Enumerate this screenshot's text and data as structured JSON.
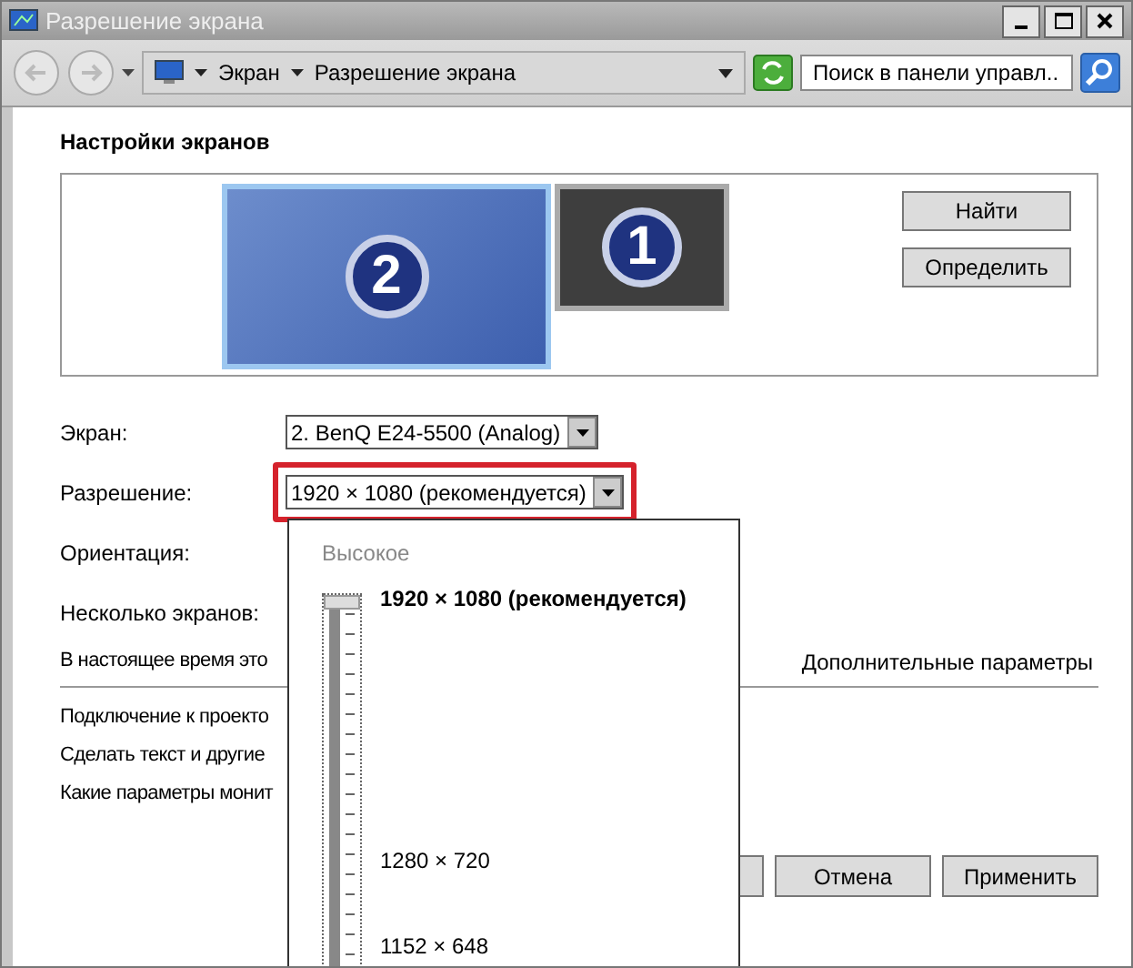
{
  "window": {
    "title": "Разрешение экрана"
  },
  "nav": {
    "breadcrumb": [
      "Экран",
      "Разрешение экрана"
    ],
    "search": {
      "placeholder": "Поиск в панели управл..."
    }
  },
  "heading": "Настройки экранов",
  "monitors": [
    {
      "number": "2",
      "selected": true
    },
    {
      "number": "1",
      "selected": false
    }
  ],
  "monitor_buttons": [
    "Найти",
    "Определить"
  ],
  "fields": [
    {
      "label": "Экран:",
      "value": "2. BenQ E24-5500 (Analog)",
      "highlighted": false
    },
    {
      "label": "Разрешение:",
      "value": "1920 × 1080 (рекомендуется)",
      "highlighted": true
    },
    {
      "label": "Ориентация:"
    },
    {
      "label": "Несколько экранов:"
    }
  ],
  "status_text": "В настоящее время это",
  "advanced_link": "Дополнительные параметры",
  "links": [
    "Подключение к проекто",
    "Сделать текст и другие",
    "Какие параметры монит"
  ],
  "buttons": [
    "Отмена",
    "Применить"
  ],
  "resolution_dropdown": {
    "high_label": "Высокое",
    "level": 1,
    "options": [
      {
        "label": "1920 × 1080 (рекомендуется)",
        "selected": true
      },
      {
        "label": "1280 × 720",
        "selected": false
      },
      {
        "label": "1152 × 648",
        "selected": false
      }
    ]
  }
}
